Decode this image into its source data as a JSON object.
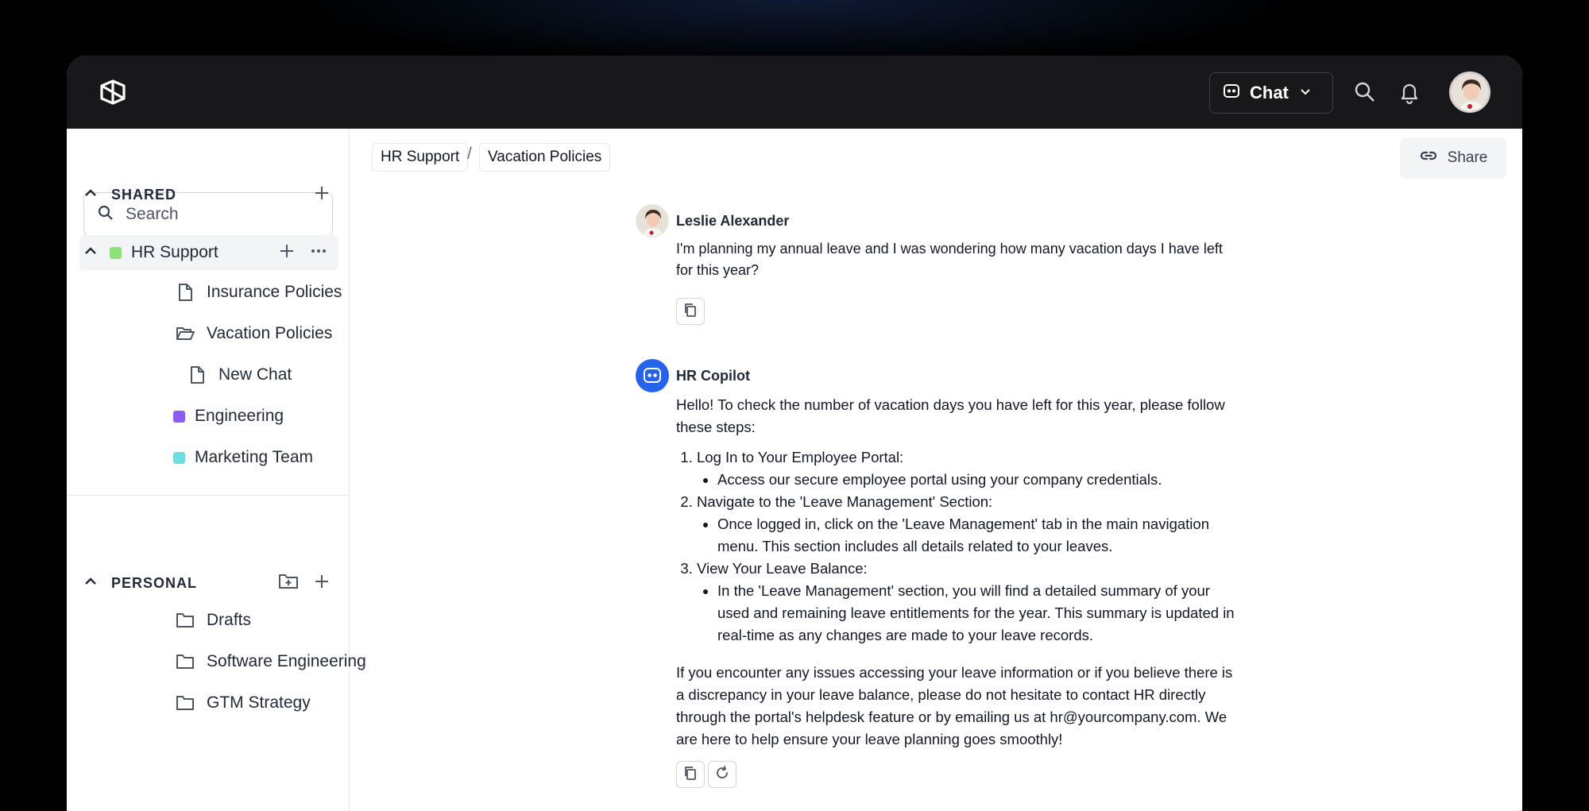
{
  "topbar": {
    "mode_label": "Chat"
  },
  "sidebar": {
    "search_placeholder": "Search",
    "shared": {
      "title": "SHARED",
      "items": [
        {
          "label": "HR Support",
          "color": "#8ee07a"
        },
        {
          "label": "Insurance Policies"
        },
        {
          "label": "Vacation Policies"
        },
        {
          "label": "New Chat"
        },
        {
          "label": "Engineering",
          "color": "#8b5cf6"
        },
        {
          "label": "Marketing Team",
          "color": "#6fdede"
        }
      ]
    },
    "personal": {
      "title": "PERSONAL",
      "items": [
        {
          "label": "Drafts"
        },
        {
          "label": "Software Engineering"
        },
        {
          "label": "GTM Strategy"
        }
      ]
    }
  },
  "main": {
    "breadcrumb": [
      "HR Support",
      "/",
      "Vacation Policies"
    ],
    "share_label": "Share",
    "messages": [
      {
        "sender": "Leslie Alexander",
        "text": "I'm planning my annual leave and I was wondering how many vacation days I have left for this year?"
      },
      {
        "sender": "HR Copilot",
        "intro": "Hello! To check the number of vacation days you have left for this year, please follow these steps:",
        "steps": [
          {
            "title": "Log In to Your Employee Portal:",
            "detail": "Access our secure employee portal using your company credentials."
          },
          {
            "title": "Navigate to the 'Leave Management' Section:",
            "detail": "Once logged in, click on the 'Leave Management' tab in the main navigation menu. This section includes all details related to your leaves."
          },
          {
            "title": "View Your Leave Balance:",
            "detail": "In the 'Leave Management' section, you will find a detailed summary of your used and remaining leave entitlements for the year. This summary is updated in real-time as any changes are made to your leave records."
          }
        ],
        "outro": "If you encounter any issues accessing your leave information or if you believe there is a discrepancy in your leave balance, please do not hesitate to contact HR directly through the portal's helpdesk feature or by emailing us at hr@yourcompany.com. We are here to help ensure your leave planning goes smoothly!"
      }
    ]
  },
  "colors": {
    "topbar_bg": "#18181b",
    "bot_avatar": "#2563eb"
  }
}
